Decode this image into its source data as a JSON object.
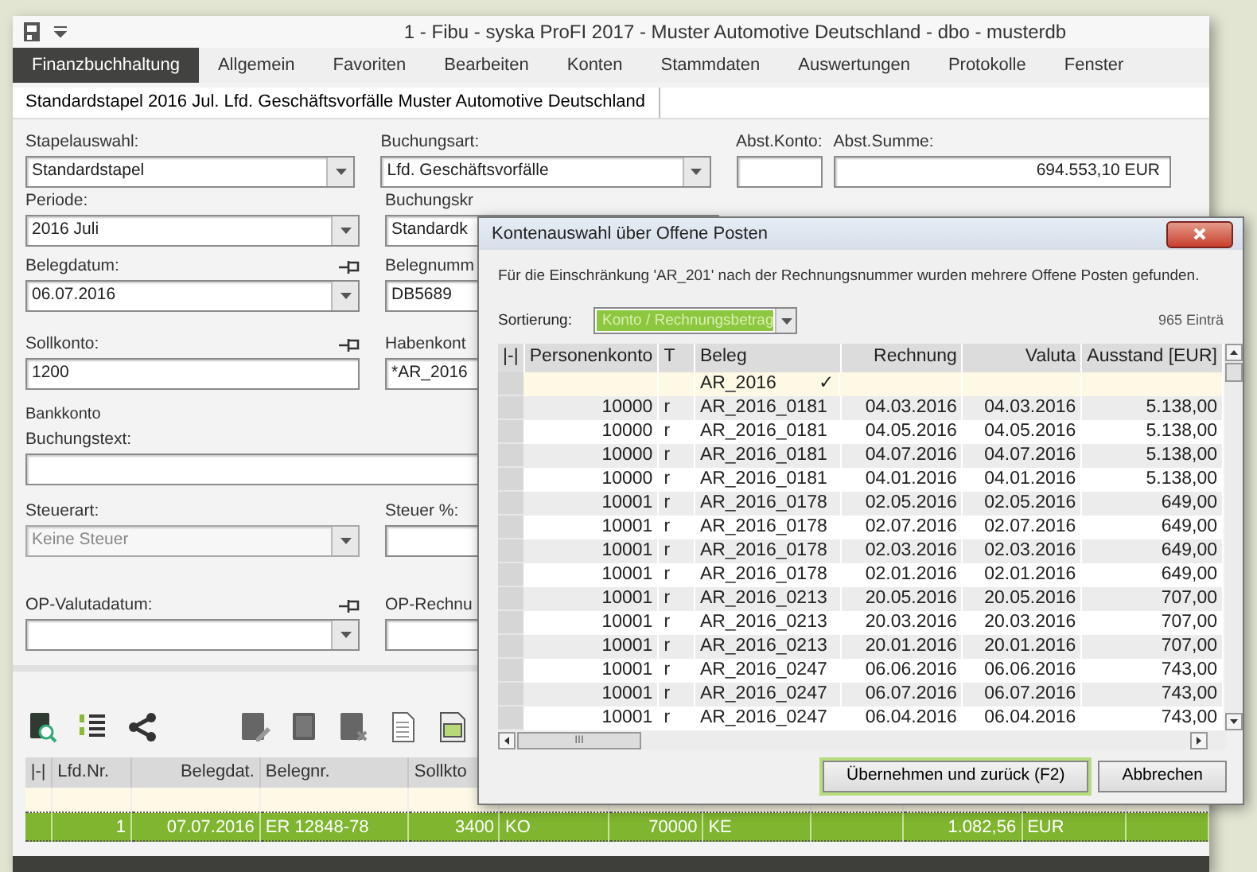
{
  "window": {
    "title": "1 - Fibu - syska ProFI 2017 - Muster Automotive Deutschland - dbo - musterdb"
  },
  "menu": [
    {
      "label": "Finanzbuchhaltung",
      "selected": true
    },
    {
      "label": "Allgemein",
      "selected": false
    },
    {
      "label": "Favoriten",
      "selected": false
    },
    {
      "label": "Bearbeiten",
      "selected": false
    },
    {
      "label": "Konten",
      "selected": false
    },
    {
      "label": "Stammdaten",
      "selected": false
    },
    {
      "label": "Auswertungen",
      "selected": false
    },
    {
      "label": "Protokolle",
      "selected": false
    },
    {
      "label": "Fenster",
      "selected": false
    }
  ],
  "doc_tabs": [
    {
      "label": "Standardstapel 2016 Jul. Lfd. Geschäftsvorfälle Muster Automotive Deutschland",
      "selected": true
    }
  ],
  "form": {
    "rows": [
      {
        "fields": [
          {
            "label": "Stapelauswahl:",
            "kind": "combo",
            "value": "Standardstapel",
            "pinned": false,
            "disabled": false
          },
          {
            "label": "Buchungsart:",
            "kind": "combo",
            "value": "Lfd. Geschäftsvorfälle",
            "pinned": false,
            "disabled": false
          },
          {
            "label": "Abst.Konto:",
            "kind": "text",
            "pinned": false,
            "disabled": false
          },
          {
            "label": "Abst.Summe:",
            "kind": "amount",
            "value": "694.553,10 EUR",
            "pinned": false,
            "disabled": false
          }
        ]
      },
      {
        "fields": [
          {
            "label": "Periode:",
            "kind": "combo",
            "value": "2016  Juli",
            "pinned": false,
            "disabled": false
          },
          {
            "label": "Buchungskr",
            "kind": "combo",
            "value": "Standardk",
            "pinned": false,
            "disabled": false
          }
        ]
      },
      {
        "fields": [
          {
            "label": "Belegdatum:",
            "kind": "combo",
            "value": "06.07.2016",
            "pinned": true,
            "disabled": false
          },
          {
            "label": "Belegnumm",
            "kind": "text",
            "value": "DB5689",
            "pinned": false,
            "disabled": false
          }
        ]
      },
      {
        "fields": [
          {
            "label": "Sollkonto:",
            "kind": "text",
            "value": "1200",
            "pinned": true,
            "disabled": false
          },
          {
            "label": "Habenkont",
            "kind": "text",
            "value": "*AR_2016",
            "pinned": false,
            "disabled": false
          }
        ]
      },
      {
        "note": "Bankkonto"
      },
      {
        "fields": [
          {
            "label": "Buchungstext:",
            "kind": "text",
            "pinned": false,
            "disabled": false
          }
        ]
      },
      {
        "fields": [
          {
            "label": "Steuerart:",
            "kind": "combo",
            "value": "Keine Steuer",
            "pinned": false,
            "disabled": true
          },
          {
            "label": "Steuer %:",
            "kind": "text",
            "pinned": false,
            "disabled": false
          }
        ]
      },
      {
        "fields": [
          {
            "label": "OP-Valutadatum:",
            "kind": "combo",
            "pinned": true,
            "disabled": false
          },
          {
            "label": "OP-Rechnu",
            "kind": "text",
            "pinned": false,
            "disabled": false
          }
        ]
      }
    ]
  },
  "journal": {
    "column_chooser": "|-|",
    "columns": [
      "Lfd.Nr.",
      "Belegdat.",
      "Belegnr.",
      "Sollkto"
    ],
    "rows": [
      {
        "selected": true,
        "cells": [
          "1",
          "07.07.2016",
          "ER 12848-78",
          "3400",
          "KO",
          "70000",
          "KE",
          "1.082,56",
          "EUR"
        ]
      }
    ]
  },
  "dialog": {
    "title": "Kontenauswahl über Offene Posten",
    "message": "Für die Einschränkung  'AR_201' nach der Rechnungsnummer wurden mehrere Offene Posten gefunden.",
    "sort_label": "Sortierung:",
    "sort_value": "Konto / Rechnungsbetrag",
    "count": "965 Einträ",
    "column_chooser": "|-|",
    "columns": [
      "Personenkonto",
      "T",
      "Beleg",
      "Rechnung",
      "Valuta",
      "Ausstand [EUR]"
    ],
    "filter": {
      "beleg": "AR_2016",
      "mark": "✓"
    },
    "rows": [
      [
        "10000",
        "r",
        "AR_2016_0181",
        "04.03.2016",
        "04.03.2016",
        "5.138,00"
      ],
      [
        "10000",
        "r",
        "AR_2016_0181",
        "04.05.2016",
        "04.05.2016",
        "5.138,00"
      ],
      [
        "10000",
        "r",
        "AR_2016_0181",
        "04.07.2016",
        "04.07.2016",
        "5.138,00"
      ],
      [
        "10000",
        "r",
        "AR_2016_0181",
        "04.01.2016",
        "04.01.2016",
        "5.138,00"
      ],
      [
        "10001",
        "r",
        "AR_2016_0178",
        "02.05.2016",
        "02.05.2016",
        "649,00"
      ],
      [
        "10001",
        "r",
        "AR_2016_0178",
        "02.07.2016",
        "02.07.2016",
        "649,00"
      ],
      [
        "10001",
        "r",
        "AR_2016_0178",
        "02.03.2016",
        "02.03.2016",
        "649,00"
      ],
      [
        "10001",
        "r",
        "AR_2016_0178",
        "02.01.2016",
        "02.01.2016",
        "649,00"
      ],
      [
        "10001",
        "r",
        "AR_2016_0213",
        "20.05.2016",
        "20.05.2016",
        "707,00"
      ],
      [
        "10001",
        "r",
        "AR_2016_0213",
        "20.03.2016",
        "20.03.2016",
        "707,00"
      ],
      [
        "10001",
        "r",
        "AR_2016_0213",
        "20.01.2016",
        "20.01.2016",
        "707,00"
      ],
      [
        "10001",
        "r",
        "AR_2016_0247",
        "06.06.2016",
        "06.06.2016",
        "743,00"
      ],
      [
        "10001",
        "r",
        "AR_2016_0247",
        "06.07.2016",
        "06.07.2016",
        "743,00"
      ],
      [
        "10001",
        "r",
        "AR_2016_0247",
        "06.04.2016",
        "06.04.2016",
        "743,00"
      ]
    ],
    "hscroll_grip": "III",
    "buttons": [
      {
        "label": "Übernehmen und zurück (F2)",
        "default": true
      },
      {
        "label": "Abbrechen",
        "default": false
      }
    ]
  }
}
